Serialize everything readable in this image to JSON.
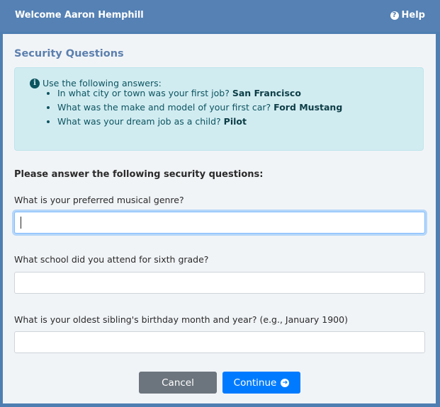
{
  "header": {
    "title": "Welcome Aaron Hemphill",
    "help_label": "Help",
    "help_icon": "question-circle-icon"
  },
  "section_title": "Security Questions",
  "alert": {
    "icon": "info-circle-icon",
    "intro": "Use the following answers:",
    "items": [
      {
        "question": "In what city or town was your first job?",
        "answer": "San Francisco"
      },
      {
        "question": "What was the make and model of your first car?",
        "answer": "Ford Mustang"
      },
      {
        "question": "What was your dream job as a child?",
        "answer": "Pilot"
      }
    ]
  },
  "form": {
    "prompt": "Please answer the following security questions:",
    "questions": [
      {
        "label": "What is your preferred musical genre?",
        "value": ""
      },
      {
        "label": "What school did you attend for sixth grade?",
        "value": ""
      },
      {
        "label": "What is your oldest sibling's birthday month and year? (e.g., January 1900)",
        "value": ""
      }
    ]
  },
  "buttons": {
    "cancel_label": "Cancel",
    "continue_label": "Continue",
    "continue_icon": "arrow-circle-right-icon"
  },
  "colors": {
    "header": "#5581b4",
    "section_title": "#5b7fae",
    "alert_bg": "#d1ecf1",
    "cancel": "#6c757d",
    "continue": "#007bff"
  }
}
